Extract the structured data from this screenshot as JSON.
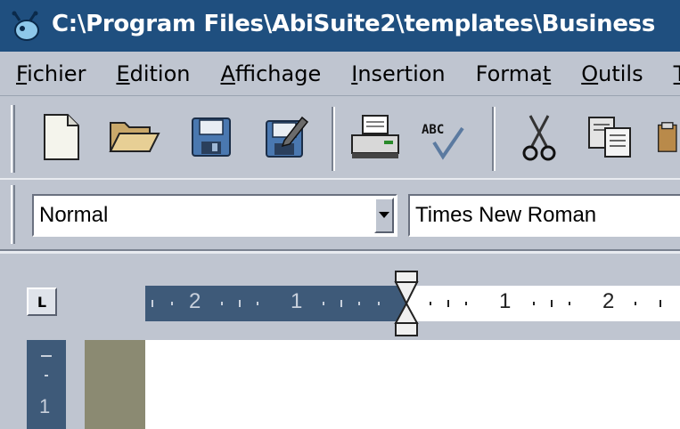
{
  "window": {
    "title": "C:\\Program Files\\AbiSuite2\\templates\\Business"
  },
  "menu": {
    "items": [
      {
        "underline": "F",
        "rest": "ichier"
      },
      {
        "underline": "E",
        "rest": "dition"
      },
      {
        "underline": "A",
        "rest": "ffichage"
      },
      {
        "underline": "I",
        "rest": "nsertion"
      },
      {
        "underline": "",
        "rest": "Forma",
        "tail_underline": "t"
      },
      {
        "underline": "O",
        "rest": "utils"
      },
      {
        "underline": "T",
        "rest": ""
      }
    ]
  },
  "toolbar": {
    "icons": [
      "new-document-icon",
      "open-folder-icon",
      "save-icon",
      "save-as-icon",
      "print-icon",
      "spellcheck-icon",
      "cut-icon",
      "copy-icon",
      "paste-icon"
    ],
    "spell_label": "ABC"
  },
  "format_bar": {
    "style_value": "Normal",
    "font_value": "Times New Roman"
  },
  "ruler": {
    "tab_stop_label": "L",
    "left_numbers": [
      "2",
      "1"
    ],
    "right_numbers": [
      "1",
      "2"
    ],
    "vertical_number": "1"
  },
  "colors": {
    "titlebar": "#1f4f7f",
    "chrome": "#bfc5d0",
    "ruler_dark": "#3e5a79",
    "margin": "#8b8a72"
  }
}
